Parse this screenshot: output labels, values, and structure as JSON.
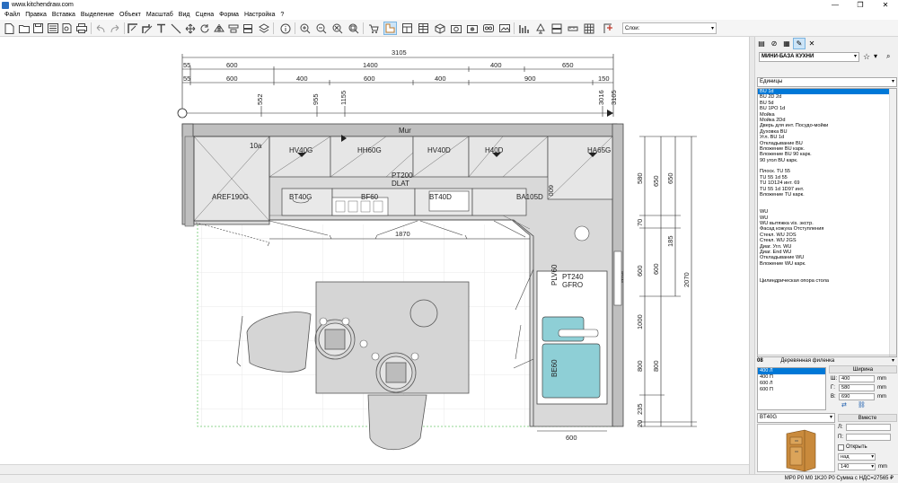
{
  "window": {
    "title": "www.kitchendraw.com",
    "controls": [
      "—",
      "❐",
      "✕"
    ]
  },
  "menu": [
    "Файл",
    "Правка",
    "Вставка",
    "Выделение",
    "Объект",
    "Масштаб",
    "Вид",
    "Сцена",
    "Форма",
    "Настройка",
    "?"
  ],
  "toolbar": {
    "layer_placeholder": "Слои:"
  },
  "drawing": {
    "dims_top_total": "3105",
    "dims_row1": [
      "55",
      "600",
      "1400",
      "400",
      "650"
    ],
    "dims_row2": [
      "55",
      "600",
      "400",
      "600",
      "400",
      "900",
      "150"
    ],
    "dims_vertical_top": [
      "552",
      "955",
      "1155",
      "3016",
      "3105"
    ],
    "dims_right_col1": [
      "580",
      "70",
      "600",
      "1000",
      "800",
      "235",
      "20"
    ],
    "dims_right_col2": [
      "650",
      "600",
      "800"
    ],
    "dims_right_col3": [
      "185"
    ],
    "dims_right_col4": [
      "2070"
    ],
    "dim_1870": "1870",
    "dim_600_bottom": "600",
    "dim_600_side": "600",
    "wall_label_top": "Mur",
    "wall_label_right": "Mur",
    "label_10a": "10a",
    "labels": {
      "hv40g": "HV40G",
      "hh60g": "HH60G",
      "hv40d": "HV40D",
      "h40d": "H40D",
      "ha65g": "HA65G",
      "pt200": "PT200",
      "dlat": "DLAT",
      "aref190g": "AREF190G",
      "bt40g": "BT40G",
      "bf60": "BF60",
      "bt40d": "BT40D",
      "ba105d": "BA105D",
      "plv60": "PLV60",
      "pt240": "PT240",
      "gfro": "GFRO",
      "be60": "BE60"
    }
  },
  "panel": {
    "catalog": "МИНИ-БАЗА КУХНИ",
    "filter": "Единицы",
    "items": [
      "BU  1d",
      "BU 2D 2d",
      "BU 5d",
      "BU 1PO 1d",
      "Мойка",
      "Мойка  2Dd",
      "Дверь для инт. Посудо-мойки",
      "Духовка BU",
      "Угл. BU  1d",
      "Откладывание BU",
      "Вложение BU карк.",
      "Вложение BU 90  карк.",
      "90  угол BU карк.",
      "",
      "Плоск. TU 55",
      "TU 55 1d  55",
      "TU 1D124 инт. 69",
      "TU 55 1d  1D97 инт.",
      "Вложение TU карк.",
      "",
      "",
      "WU",
      "WU",
      "WU вытяжка vis. экстр.",
      "Фасад кожуха Отступления",
      "Стекл. WU  2OS",
      "Стекл. WU  2GS",
      "Диаг. Угл. WU",
      "Диаг. End WU",
      "Откладывание WU",
      "Вложение WU карк.",
      "",
      "",
      "Цилиндрическая опора стола"
    ],
    "style_code": "08",
    "style_name": "Деревянная филенка",
    "sizes": [
      "400 Л",
      "400 П",
      "600 Л",
      "600 П"
    ],
    "width_header": "Ширина",
    "props": [
      {
        "label": "Ш:",
        "value": "400",
        "unit": "mm"
      },
      {
        "label": "Г:",
        "value": "580",
        "unit": "mm"
      },
      {
        "label": "В:",
        "value": "690",
        "unit": "mm"
      }
    ],
    "item_code": "BT40G",
    "insert_header": "Вместе",
    "insert_l": "Л:",
    "insert_p": "П:",
    "open_label": "Открыть",
    "placement": "над",
    "height_value": "140",
    "height_unit": "mm"
  },
  "status": "MP0 P0 M0  1K20 P0 Сумма с НДС=27565 ₽"
}
